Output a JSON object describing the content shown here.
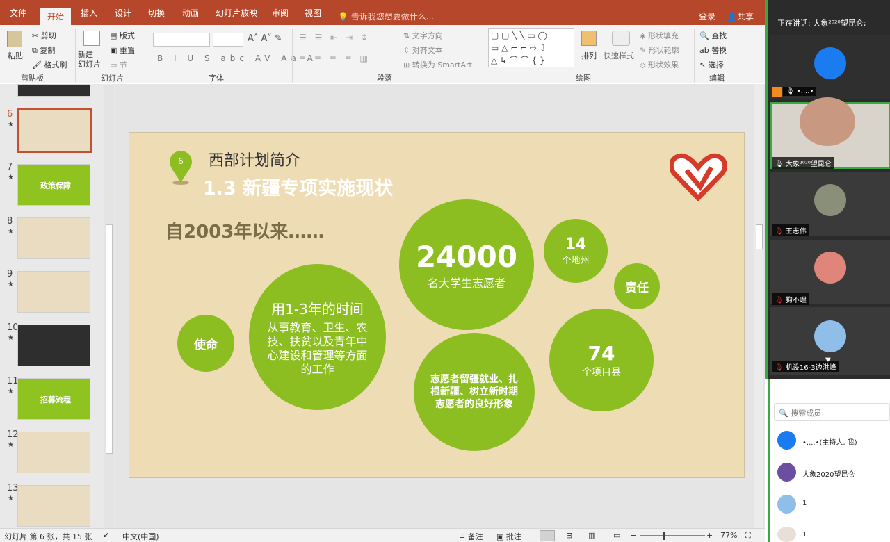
{
  "ribbon": {
    "tabs": [
      "文件",
      "开始",
      "插入",
      "设计",
      "切换",
      "动画",
      "幻灯片放映",
      "审阅",
      "视图"
    ],
    "tellme": "告诉我您想要做什么...",
    "login": "登录",
    "share": "共享",
    "clipboard": {
      "paste": "粘贴",
      "cut": "剪切",
      "copy": "复制",
      "painter": "格式刷",
      "label": "剪贴板"
    },
    "slides": {
      "new": "新建\n幻灯片",
      "layout": "版式",
      "reset": "重置",
      "section": "节",
      "label": "幻灯片"
    },
    "font": {
      "label": "字体"
    },
    "paragraph": {
      "textdir": "文字方向",
      "align": "对齐文本",
      "smartart": "转换为 SmartArt",
      "label": "段落"
    },
    "drawing": {
      "arrange": "排列",
      "quickstyle": "快速样式",
      "fill": "形状填充",
      "outline": "形状轮廓",
      "effects": "形状效果",
      "label": "绘图"
    },
    "editing": {
      "find": "查找",
      "replace": "替换",
      "select": "选择",
      "label": "编辑"
    }
  },
  "thumbs": [
    {
      "num": "6",
      "label": ""
    },
    {
      "num": "7",
      "label": "政策保障"
    },
    {
      "num": "8",
      "label": ""
    },
    {
      "num": "9",
      "label": ""
    },
    {
      "num": "10",
      "label": ""
    },
    {
      "num": "11",
      "label": "招募流程"
    },
    {
      "num": "12",
      "label": ""
    },
    {
      "num": "13",
      "label": ""
    }
  ],
  "slide": {
    "badge": "6",
    "title": "西部计划简介",
    "subtitle": "1.3 新疆专项实施现状",
    "since": "自2003年以来……",
    "circles": {
      "mission": "使命",
      "time_head": "用1-3年的时间",
      "time_body": "从事教育、卫生、农技、扶贫以及青年中心建设和管理等方面的工作",
      "big_num": "24000",
      "big_label": "名大学生志愿者",
      "prefect_num": "14",
      "prefect_label": "个地州",
      "duty": "责任",
      "stay": "志愿者留疆就业、扎根新疆、树立新时期志愿者的良好形象",
      "county_num": "74",
      "county_label": "个项目县"
    }
  },
  "status": {
    "slideinfo": "幻灯片 第 6 张，共 15 张",
    "lang": "中文(中国)",
    "notes": "备注",
    "comments": "批注",
    "zoom": "77%"
  },
  "meeting": {
    "speaking": "正在讲话: 大象²⁰²⁰望昆仑;",
    "tiles": [
      {
        "name": "•....•"
      },
      {
        "name": "大象²⁰²⁰望昆仑"
      },
      {
        "name": "王志伟"
      },
      {
        "name": "狗不理"
      },
      {
        "name": "机设16-3边洪峰"
      }
    ],
    "search": "搜索成员",
    "members": [
      "•....•(主持人, 我)",
      "大象2020望昆仑",
      "1",
      "1"
    ]
  }
}
